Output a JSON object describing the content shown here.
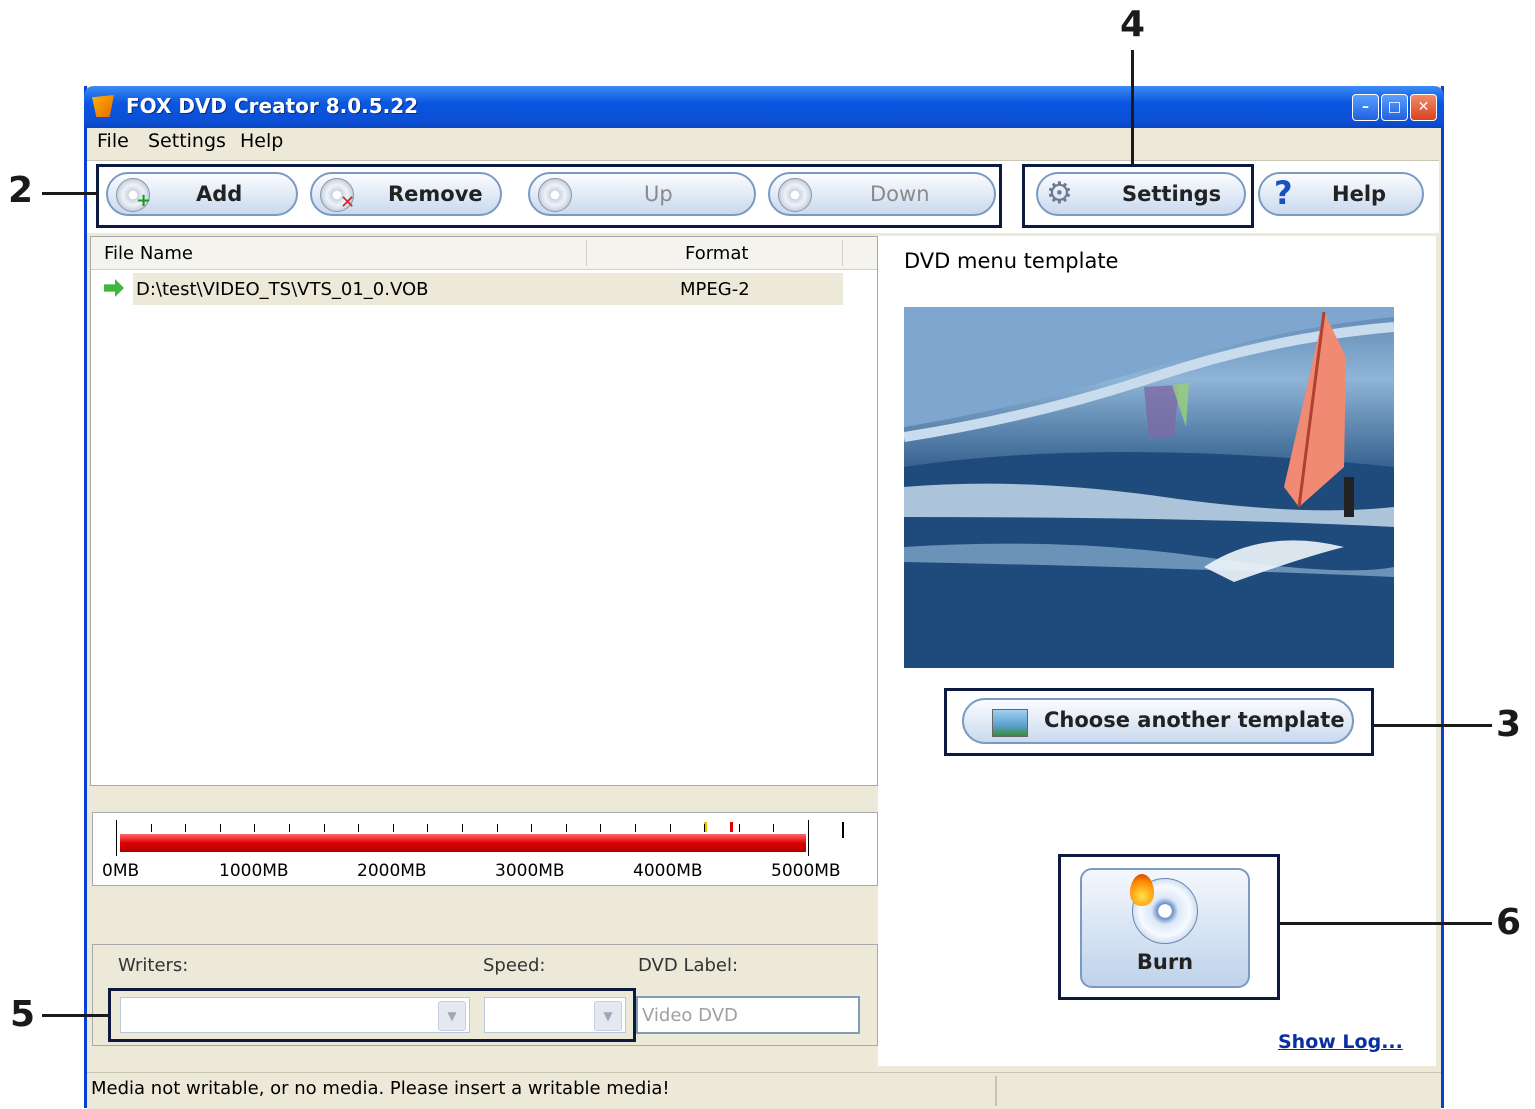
{
  "window": {
    "title": "FOX DVD Creator 8.0.5.22"
  },
  "menu": [
    "File",
    "Settings",
    "Help"
  ],
  "toolbar": {
    "add": "Add",
    "remove": "Remove",
    "up": "Up",
    "down": "Down",
    "settings": "Settings",
    "help": "Help"
  },
  "file_list": {
    "columns": [
      "File Name",
      "Format"
    ],
    "rows": [
      {
        "name": "D:\\test\\VIDEO_TS\\VTS_01_0.VOB",
        "format": "MPEG-2"
      }
    ]
  },
  "template": {
    "label": "DVD menu template",
    "choose_button": "Choose another template"
  },
  "capacity": {
    "labels": [
      "0MB",
      "1000MB",
      "2000MB",
      "3000MB",
      "4000MB",
      "5000MB"
    ],
    "used_fraction": 1.0
  },
  "writer_group": {
    "writers_label": "Writers:",
    "speed_label": "Speed:",
    "dvd_label_label": "DVD Label:",
    "dvd_label_value": "Video DVD"
  },
  "burn": {
    "label": "Burn",
    "show_log": "Show Log..."
  },
  "status": {
    "message": "Media not writable, or no media. Please insert a writable media!"
  },
  "callouts": [
    "2",
    "3",
    "4",
    "5",
    "6"
  ],
  "colors": {
    "title_bar": "#0a56e0",
    "capacity_bar": "#e00000",
    "highlight_box": "#0c1a3f"
  }
}
